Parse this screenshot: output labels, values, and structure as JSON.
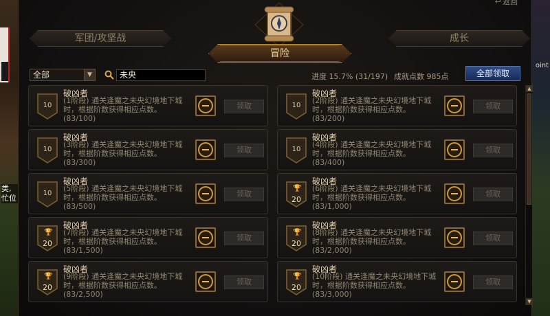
{
  "background": {
    "left_text": "类,\n忙位",
    "right_text": "oint"
  },
  "window": {
    "back_label": "返回"
  },
  "tabs": {
    "left": "军团/攻坚战",
    "center": "冒险",
    "right": "成长"
  },
  "filter": {
    "category_value": "全部",
    "search_value": "未央",
    "progress": "进度 15.7% (31/197)",
    "points": "成就点数 985点",
    "claim_all": "全部领取"
  },
  "achievements": [
    {
      "title": "破凶者",
      "desc": "(1阶段) 通关逢魔之未央幻境地下城时，根据阶数获得相应点数。",
      "progress": "(83/100)",
      "points": "10",
      "trophy": false,
      "claim": "领取"
    },
    {
      "title": "破凶者",
      "desc": "(2阶段) 通关逢魔之未央幻境地下城时，根据阶数获得相应点数。",
      "progress": "(83/200)",
      "points": "10",
      "trophy": false,
      "claim": "领取"
    },
    {
      "title": "破凶者",
      "desc": "(3阶段) 通关逢魔之未央幻境地下城时，根据阶数获得相应点数。",
      "progress": "(83/300)",
      "points": "10",
      "trophy": false,
      "claim": "领取"
    },
    {
      "title": "破凶者",
      "desc": "(4阶段) 通关逢魔之未央幻境地下城时，根据阶数获得相应点数。",
      "progress": "(83/400)",
      "points": "10",
      "trophy": false,
      "claim": "领取"
    },
    {
      "title": "破凶者",
      "desc": "(5阶段) 通关逢魔之未央幻境地下城时，根据阶数获得相应点数。",
      "progress": "(83/500)",
      "points": "10",
      "trophy": false,
      "claim": "领取"
    },
    {
      "title": "破凶者",
      "desc": "(6阶段) 通关逢魔之未央幻境地下城时，根据阶数获得相应点数。",
      "progress": "(83/1,000)",
      "points": "20",
      "trophy": true,
      "claim": "领取"
    },
    {
      "title": "破凶者",
      "desc": "(7阶段) 通关逢魔之未央幻境地下城时，根据阶数获得相应点数。",
      "progress": "(83/1,500)",
      "points": "20",
      "trophy": true,
      "claim": "领取"
    },
    {
      "title": "破凶者",
      "desc": "(8阶段) 通关逢魔之未央幻境地下城时，根据阶数获得相应点数。",
      "progress": "(83/2,000)",
      "points": "20",
      "trophy": true,
      "claim": "领取"
    },
    {
      "title": "破凶者",
      "desc": "(9阶段) 通关逢魔之未央幻境地下城时，根据阶数获得相应点数。",
      "progress": "(83/2,500)",
      "points": "20",
      "trophy": true,
      "claim": "领取"
    },
    {
      "title": "破凶者",
      "desc": "(10阶段) 通关逢魔之未央幻境地下城时，根据阶数获得相应点数。",
      "progress": "(83/3,000)",
      "points": "20",
      "trophy": true,
      "claim": "领取"
    }
  ]
}
